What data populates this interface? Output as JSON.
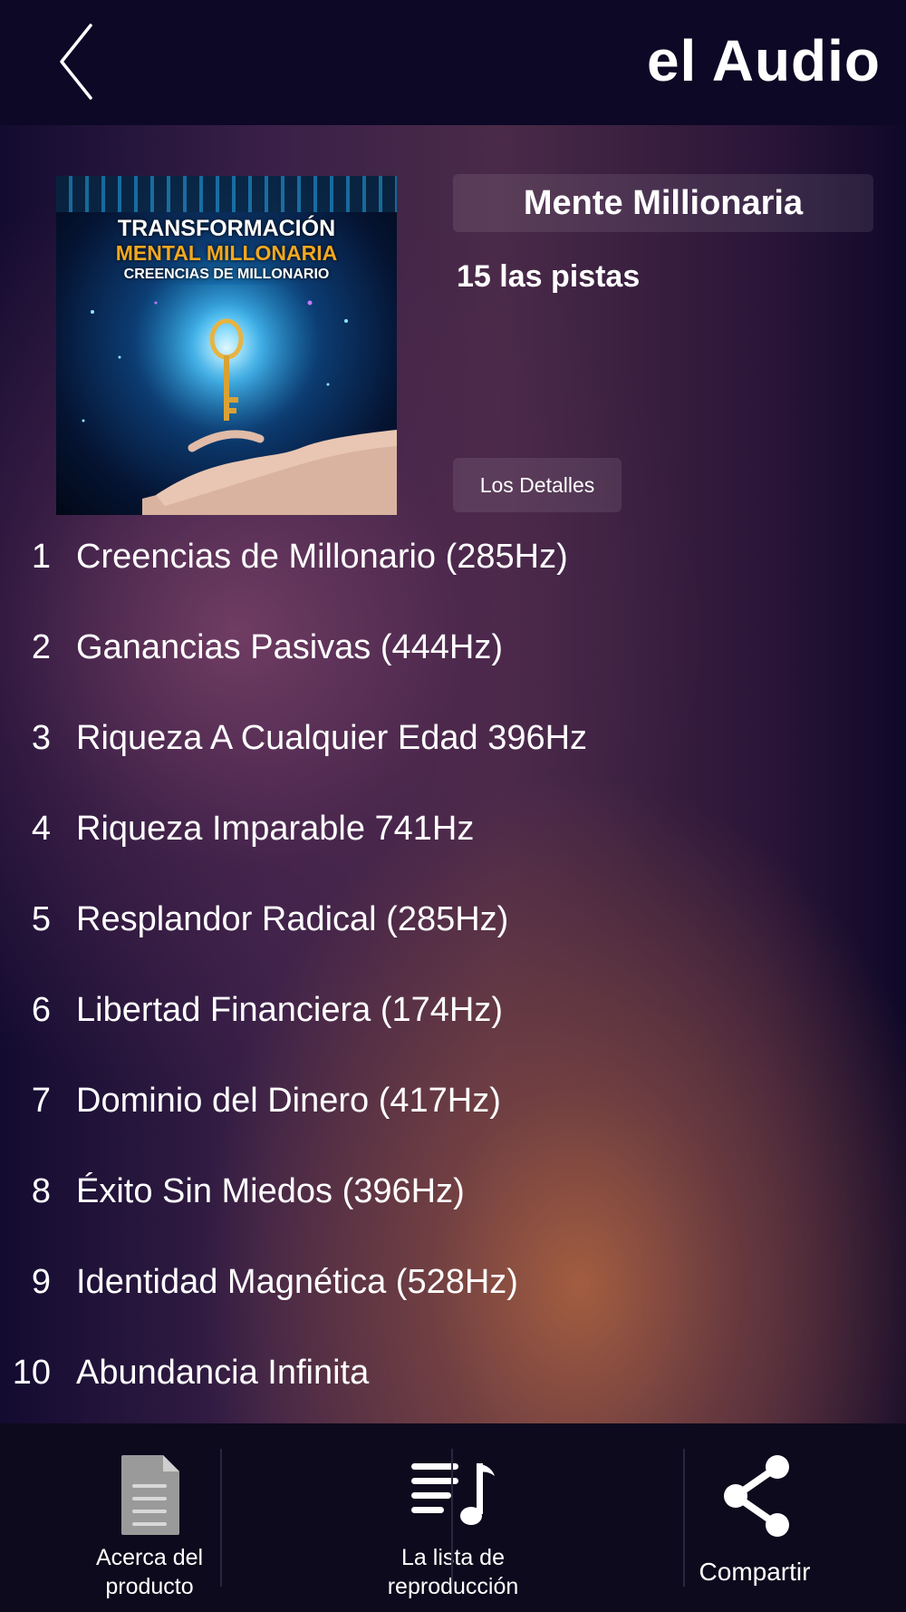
{
  "header": {
    "title": "el Audio",
    "back_icon": "chevron-left-icon"
  },
  "album": {
    "cover_lines": [
      "TRANSFORMACIÓN",
      "MENTAL MILLONARIA",
      "CREENCIAS DE MILLONARIO"
    ],
    "title": "Mente Millionaria",
    "track_count": "15 las pistas",
    "details_label": "Los Detalles"
  },
  "tracks": [
    {
      "num": "1",
      "title": "Creencias de Millonario (285Hz)"
    },
    {
      "num": "2",
      "title": "Ganancias Pasivas (444Hz)"
    },
    {
      "num": "3",
      "title": "Riqueza A Cualquier Edad 396Hz"
    },
    {
      "num": "4",
      "title": "Riqueza Imparable 741Hz"
    },
    {
      "num": "5",
      "title": "Resplandor Radical (285Hz)"
    },
    {
      "num": "6",
      "title": "Libertad Financiera (174Hz)"
    },
    {
      "num": "7",
      "title": "Dominio del Dinero (417Hz)"
    },
    {
      "num": "8",
      "title": "Éxito Sin Miedos (396Hz)"
    },
    {
      "num": "9",
      "title": "Identidad Magnética (528Hz)"
    },
    {
      "num": "10",
      "title": "Abundancia Infinita"
    }
  ],
  "bottom_nav": [
    {
      "label": "Acerca del\nproducto",
      "icon": "document-icon"
    },
    {
      "label": "La lista de\nreproducción",
      "icon": "playlist-icon"
    },
    {
      "label": "Compartir",
      "icon": "share-icon"
    }
  ],
  "colors": {
    "header_bg": "#0c0825",
    "bottom_bg": "#0d0a1d",
    "cover_accent": "#f3a81f",
    "text": "#ffffff"
  }
}
